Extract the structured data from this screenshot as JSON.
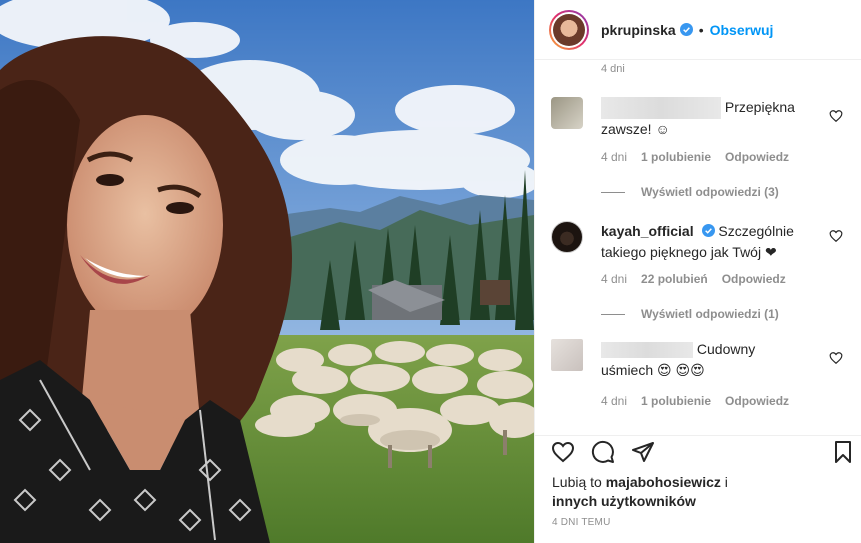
{
  "post": {
    "image_alt": "Selfie z owcami w górach"
  },
  "header": {
    "username": "pkrupinska",
    "separator": "•",
    "follow_label": "Obserwuj"
  },
  "comments": {
    "top_time": "4 dni",
    "items": [
      {
        "text": "Przepiękna zawsze! ☺",
        "time": "4 dni",
        "likes": "1 polubienie",
        "reply": "Odpowiedz",
        "view_replies": "Wyświetl odpowiedzi (3)"
      },
      {
        "username": "kayah_official",
        "text": "Szczególnie takiego pięknego jak Twój ❤",
        "time": "4 dni",
        "likes": "22 polubień",
        "reply": "Odpowiedz",
        "view_replies": "Wyświetl odpowiedzi (1)"
      },
      {
        "text": "Cudowny uśmiech 😍 😍😍",
        "time": "4 dni",
        "likes": "1 polubienie",
        "reply": "Odpowiedz"
      }
    ]
  },
  "footer": {
    "liked_by_prefix": "Lubią to",
    "liked_by_user": "majabohosiewicz",
    "liked_by_and": "i",
    "liked_by_others": "innych użytkowników",
    "post_time": "4 DNI TEMU"
  },
  "colors": {
    "accent": "#0095f6",
    "verified": "#3897f0",
    "heart_red": "#ed4956",
    "meta_gray": "#8e8e8e"
  }
}
